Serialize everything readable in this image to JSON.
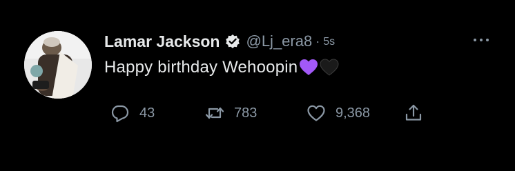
{
  "tweet": {
    "author_name": "Lamar Jackson",
    "handle": "@Lj_era8",
    "separator": "·",
    "time": "5s",
    "text": "Happy birthday Wehoopin",
    "replies": "43",
    "retweets": "783",
    "likes": "9,368"
  },
  "icons": {
    "verified": "verified-badge-icon",
    "more": "more-icon",
    "reply": "reply-icon",
    "retweet": "retweet-icon",
    "like": "like-icon",
    "share": "share-icon",
    "emoji_1": "purple-heart-emoji",
    "emoji_2": "black-heart-emoji"
  },
  "colors": {
    "background": "#000000",
    "primary_text": "#e7e9ea",
    "secondary_text": "#8b98a5",
    "purple_heart": "#a259f7"
  }
}
